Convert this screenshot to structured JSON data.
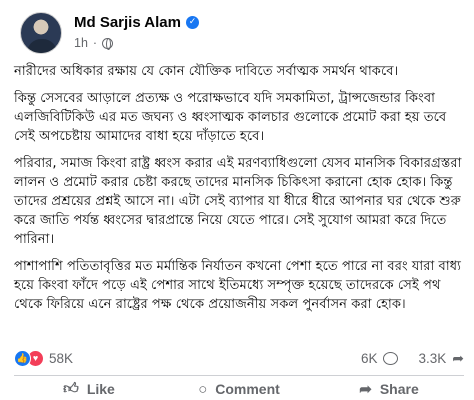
{
  "post": {
    "author": "Md Sarjis Alam",
    "time": "1h",
    "separator": "·",
    "paragraphs": [
      "নারীদের অধিকার রক্ষায় যে কোন যৌক্তিক দাবিতে সর্বাত্মক সমর্থন থাকবে।",
      "কিন্তু সেসবের আড়ালে প্রত্যক্ষ ও পরোক্ষভাবে যদি সমকামিতা, ট্রান্সজেন্ডার কিংবা এলজিবিটিকিউ এর মত জঘন্য ও ধ্বংসাত্মক কালচার গুলোকে প্রমোট করা হয় তবে সেই অপচেষ্টায় আমাদের বাধা হয়ে দাঁড়াতে হবে।",
      "পরিবার, সমাজ কিংবা রাষ্ট্র ধ্বংস করার এই মরণব্যাধিগুলো যেসব মানসিক বিকারগ্রস্তরা লালন ও প্রমোট করার চেষ্টা করছে তাদের মানসিক চিকিৎসা করানো হোক হোক। কিন্তু তাদের প্রশ্রয়ের প্রশ্নই আসে না। এটা সেই ব্যাপার যা ধীরে ধীরে আপনার ঘর থেকে শুরু করে জাতি পর্যন্ত ধ্বংসের দ্বারপ্রান্তে নিয়ে যেতে পারে। সেই সুযোগ আমরা করে দিতে পারিনা।",
      "পাশাপাশি পতিতাবৃত্তির মত মর্মান্তিক নির্যাতন কখনো পেশা হতে পারে না বরং যারা বাধ্য হয়ে কিংবা ফাঁদে পড়ে এই পেশার সাথে ইতিমধ্যে সম্পৃক্ত হয়েছে তাদেরকে সেই পথ থেকে ফিরিয়ে এনে রাষ্ট্রের পক্ষ থেকে প্রয়োজনীয় সকল পুনর্বাসন করা হোক।"
    ]
  },
  "stats": {
    "reactions": "58K",
    "comments": "6K",
    "shares": "3.3K"
  },
  "actions": {
    "like": "Like",
    "comment": "Comment",
    "share": "Share"
  },
  "icons": {
    "verified": "verified-badge-icon",
    "audience": "globe-icon",
    "like_reaction": "thumbs-up-icon",
    "love_reaction": "heart-icon"
  },
  "colors": {
    "brand_blue": "#1877f2",
    "love_red": "#f33e58",
    "secondary_text": "#65676b"
  }
}
